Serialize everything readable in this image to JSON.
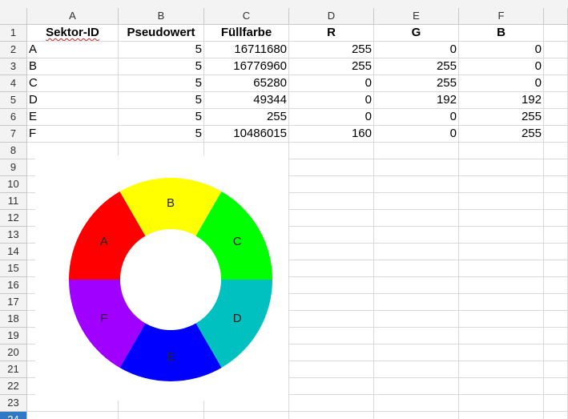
{
  "columns": [
    "A",
    "B",
    "C",
    "D",
    "E",
    "F"
  ],
  "rows": [
    {
      "num": "1",
      "cells": [
        "Sektor-ID",
        "Pseudowert",
        "Füllfarbe",
        "R",
        "G",
        "B"
      ]
    },
    {
      "num": "2",
      "cells": [
        "A",
        "5",
        "16711680",
        "255",
        "0",
        "0"
      ]
    },
    {
      "num": "3",
      "cells": [
        "B",
        "5",
        "16776960",
        "255",
        "255",
        "0"
      ]
    },
    {
      "num": "4",
      "cells": [
        "C",
        "5",
        "65280",
        "0",
        "255",
        "0"
      ]
    },
    {
      "num": "5",
      "cells": [
        "D",
        "5",
        "49344",
        "0",
        "192",
        "192"
      ]
    },
    {
      "num": "6",
      "cells": [
        "E",
        "5",
        "255",
        "0",
        "0",
        "255"
      ]
    },
    {
      "num": "7",
      "cells": [
        "F",
        "5",
        "10486015",
        "160",
        "0",
        "255"
      ]
    },
    {
      "num": "8",
      "cells": [
        "",
        "",
        "",
        "",
        "",
        ""
      ]
    },
    {
      "num": "9",
      "cells": [
        "",
        "",
        "",
        "",
        "",
        ""
      ]
    },
    {
      "num": "10",
      "cells": [
        "",
        "",
        "",
        "",
        "",
        ""
      ]
    },
    {
      "num": "11",
      "cells": [
        "",
        "",
        "",
        "",
        "",
        ""
      ]
    },
    {
      "num": "12",
      "cells": [
        "",
        "",
        "",
        "",
        "",
        ""
      ]
    },
    {
      "num": "13",
      "cells": [
        "",
        "",
        "",
        "",
        "",
        ""
      ]
    },
    {
      "num": "14",
      "cells": [
        "",
        "",
        "",
        "",
        "",
        ""
      ]
    },
    {
      "num": "15",
      "cells": [
        "",
        "",
        "",
        "",
        "",
        ""
      ]
    },
    {
      "num": "16",
      "cells": [
        "",
        "",
        "",
        "",
        "",
        ""
      ]
    },
    {
      "num": "17",
      "cells": [
        "",
        "",
        "",
        "",
        "",
        ""
      ]
    },
    {
      "num": "18",
      "cells": [
        "",
        "",
        "",
        "",
        "",
        ""
      ]
    },
    {
      "num": "19",
      "cells": [
        "",
        "",
        "",
        "",
        "",
        ""
      ]
    },
    {
      "num": "20",
      "cells": [
        "",
        "",
        "",
        "",
        "",
        ""
      ]
    },
    {
      "num": "21",
      "cells": [
        "",
        "",
        "",
        "",
        "",
        ""
      ]
    },
    {
      "num": "22",
      "cells": [
        "",
        "",
        "",
        "",
        "",
        ""
      ]
    },
    {
      "num": "23",
      "cells": [
        "",
        "",
        "",
        "",
        "",
        ""
      ]
    },
    {
      "num": "24",
      "cells": [
        "",
        "",
        "",
        "",
        "",
        ""
      ]
    }
  ],
  "active_row": "24",
  "chart_data": {
    "type": "donut",
    "categories": [
      "A",
      "B",
      "C",
      "D",
      "E",
      "F"
    ],
    "values": [
      5,
      5,
      5,
      5,
      5,
      5
    ],
    "colors": [
      "#ff0000",
      "#ffff00",
      "#00ff00",
      "#00c0c0",
      "#0000ff",
      "#a000ff"
    ],
    "legend": "none"
  }
}
